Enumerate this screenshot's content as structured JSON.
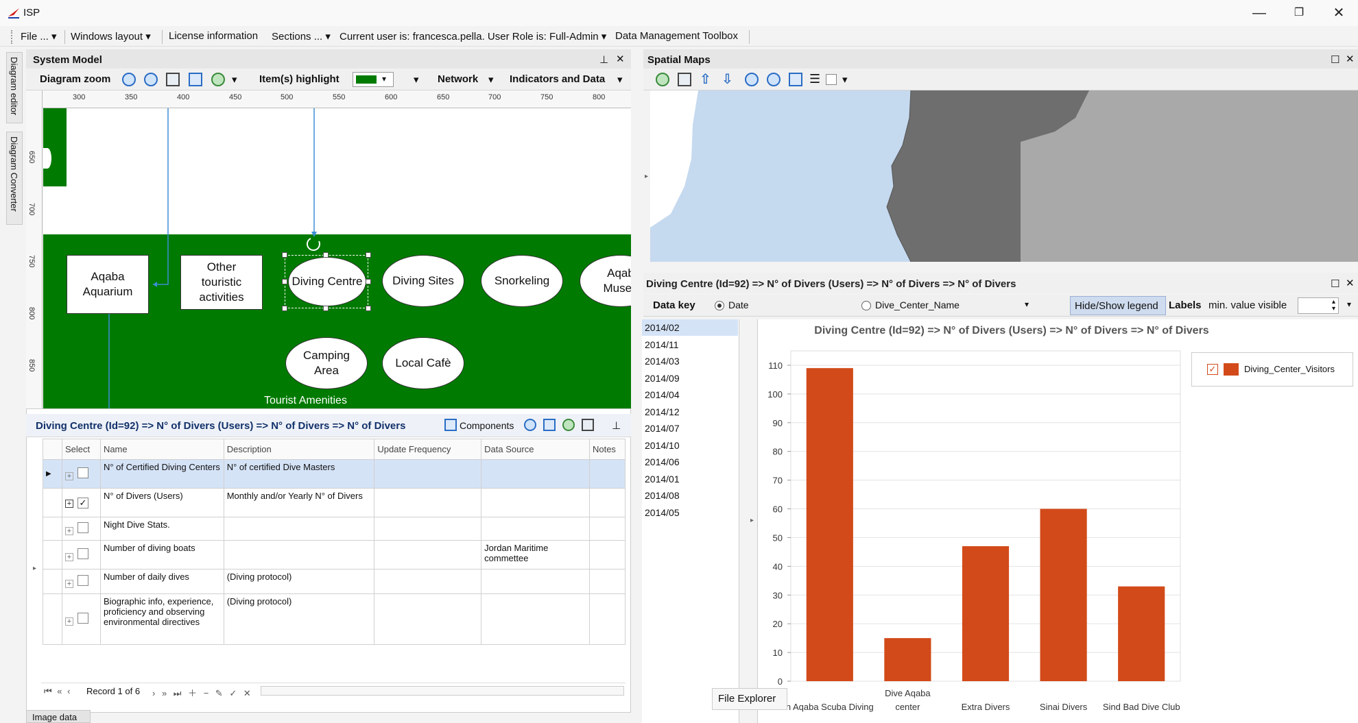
{
  "app": {
    "title": "ISP"
  },
  "window_controls": {
    "minimize": "—",
    "restore": "❐",
    "close": "✕"
  },
  "menu": [
    {
      "label": "File ..."
    },
    {
      "label": "Windows layout"
    },
    {
      "label": "License information"
    },
    {
      "label": "Sections ..."
    },
    {
      "label": "Current user is: francesca.pella. User Role is: Full-Admin"
    },
    {
      "label": "Data Management Toolbox"
    }
  ],
  "side_tabs": [
    "Diagram editor",
    "Diagram Converter"
  ],
  "system_model": {
    "title": "System Model",
    "toolbar": {
      "zoom": "Diagram zoom",
      "highlight": "Item(s) highlight",
      "network": "Network",
      "indicators": "Indicators and Data"
    },
    "ruler_x": [
      "300",
      "350",
      "400",
      "450",
      "500",
      "550",
      "600",
      "650",
      "700",
      "750",
      "800"
    ],
    "ruler_y": [
      "650",
      "700",
      "750",
      "800",
      "850"
    ],
    "nodes": [
      {
        "label": "Aqaba\nAquarium"
      },
      {
        "label": "Other\ntouristic\nactivities"
      },
      {
        "label": "Diving Centre"
      },
      {
        "label": "Diving Sites"
      },
      {
        "label": "Snorkeling"
      },
      {
        "label": "Aqab\nMuseu"
      },
      {
        "label": "Camping\nArea"
      },
      {
        "label": "Local Cafè"
      }
    ],
    "group_label": "Tourist Amenities",
    "highlight_color": "#007a00"
  },
  "indicators": {
    "title": "Diving Centre (Id=92) => N° of Divers (Users) => N° of Divers => N° of Divers",
    "components_label": "Components",
    "columns": [
      "Select",
      "Name",
      "Description",
      "Update Frequency",
      "Data Source",
      "Notes"
    ],
    "rows": [
      {
        "name": "N° of Certified Diving Centers",
        "description": "N° of certified Dive Masters",
        "update": "",
        "source": "",
        "notes": "",
        "checked": false
      },
      {
        "name": "N° of Divers (Users)",
        "description": "Monthly and/or Yearly N° of Divers",
        "update": "",
        "source": "",
        "notes": "",
        "checked": true
      },
      {
        "name": "Night Dive Stats.",
        "description": "",
        "update": "",
        "source": "",
        "notes": "",
        "checked": false
      },
      {
        "name": "Number of diving boats",
        "description": "",
        "update": "",
        "source": "Jordan Maritime commettee",
        "notes": "",
        "checked": false
      },
      {
        "name": "Number of daily dives",
        "description": "(Diving protocol)",
        "update": "",
        "source": "",
        "notes": "",
        "checked": false
      },
      {
        "name": "Biographic info, experience, proficiency and observing environmental directives",
        "description": "(Diving protocol)",
        "update": "",
        "source": "",
        "notes": "",
        "checked": false
      }
    ],
    "navigator": "Record 1 of 6"
  },
  "bottom_tab": "Image data",
  "spatial_maps": {
    "title": "Spatial Maps"
  },
  "chart_panel": {
    "title": "Diving Centre (Id=92) => N° of Divers (Users) => N° of Divers => N° of Divers",
    "data_key_label": "Data key",
    "radio_date": "Date",
    "radio_name": "Dive_Center_Name",
    "legend_toggle": "Hide/Show legend",
    "labels": "Labels",
    "min_value": "min. value  visible",
    "data_keys": [
      "2014/02",
      "2014/11",
      "2014/03",
      "2014/09",
      "2014/04",
      "2014/12",
      "2014/07",
      "2014/10",
      "2014/06",
      "2014/01",
      "2014/08",
      "2014/05"
    ],
    "tooltip": "File Explorer"
  },
  "chart_data": {
    "type": "bar",
    "title": "Diving Centre (Id=92) => N° of Divers (Users) => N° of Divers => N° of Divers",
    "categories": [
      "Aqaba Scuba Diving",
      "Dive Aqaba center",
      "Extra Divers",
      "Sinai Divers",
      "Sind Bad Dive Club"
    ],
    "tick_labels": [
      "n Aqaba Scuba Diving",
      "Dive Aqaba\ncenter",
      "Extra Divers",
      "Sinai Divers",
      "Sind Bad Dive Club"
    ],
    "series": [
      {
        "name": "Diving_Center_Visitors",
        "values": [
          109,
          15,
          47,
          60,
          33
        ],
        "color": "#d24a1a"
      }
    ],
    "yticks": [
      "0",
      "10",
      "20",
      "30",
      "40",
      "50",
      "60",
      "70",
      "80",
      "90",
      "100",
      "110"
    ],
    "ylim": [
      0,
      115
    ],
    "grid": true,
    "legend": "top-right"
  }
}
